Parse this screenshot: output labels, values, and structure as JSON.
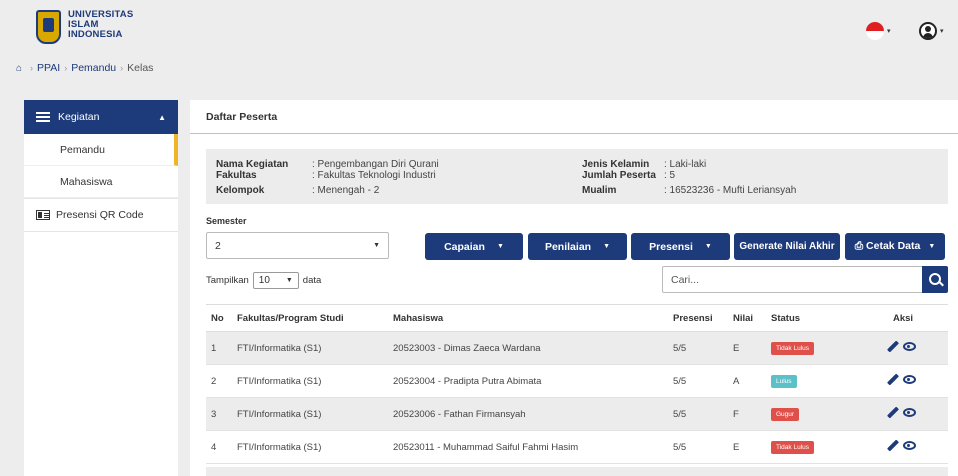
{
  "brand": {
    "line1": "UNIVERSITAS",
    "line2": "ISLAM",
    "line3": "INDONESIA",
    "colors": {
      "primary": "#1d3a7a",
      "accent": "#f0b429"
    }
  },
  "header": {
    "language_icon": "indonesia-flag-icon",
    "user_icon": "user-circle-icon"
  },
  "breadcrumb": {
    "items": [
      "PPAI",
      "Pemandu",
      "Kelas"
    ]
  },
  "sidebar": {
    "kegiatan": "Kegiatan",
    "sub_items": [
      "Pemandu",
      "Mahasiswa"
    ],
    "presensi_qr": "Presensi QR Code"
  },
  "panel": {
    "title": "Daftar Peserta",
    "info": {
      "nama_kegiatan_label": "Nama Kegiatan",
      "nama_kegiatan_value": ": Pengembangan Diri Qurani",
      "fakultas_label": "Fakultas",
      "fakultas_value": ": Fakultas Teknologi Industri",
      "kelompok_label": "Kelompok",
      "kelompok_value": ": Menengah - 2",
      "jenis_kelamin_label": "Jenis Kelamin",
      "jenis_kelamin_value": ": Laki-laki",
      "jumlah_peserta_label": "Jumlah Peserta",
      "jumlah_peserta_value": ": 5",
      "mualim_label": "Mualim",
      "mualim_value": ": 16523236 - Mufti Leriansyah"
    },
    "semester_label": "Semester",
    "semester_value": "2",
    "buttons": {
      "capaian": "Capaian",
      "penilaian": "Penilaian",
      "presensi": "Presensi",
      "generate": "Generate Nilai Akhir",
      "cetak": "⎙ Cetak Data"
    },
    "show_prefix": "Tampilkan",
    "show_value": "10",
    "show_suffix": "data",
    "search_placeholder": "Cari..."
  },
  "table": {
    "headers": {
      "no": "No",
      "fakultas": "Fakultas/Program Studi",
      "mahasiswa": "Mahasiswa",
      "presensi": "Presensi",
      "nilai": "Nilai",
      "status": "Status",
      "aksi": "Aksi"
    },
    "rows": [
      {
        "no": "1",
        "fakultas": "FTI/Informatika (S1)",
        "mahasiswa": "20523003 - Dimas Zaeca Wardana",
        "presensi": "5/5",
        "nilai": "E",
        "status": "Tidak Lulus",
        "status_color": "#e0504a"
      },
      {
        "no": "2",
        "fakultas": "FTI/Informatika (S1)",
        "mahasiswa": "20523004 - Pradipta Putra Abimata",
        "presensi": "5/5",
        "nilai": "A",
        "status": "Lulus",
        "status_color": "#5bc0c8"
      },
      {
        "no": "3",
        "fakultas": "FTI/Informatika (S1)",
        "mahasiswa": "20523006 - Fathan Firmansyah",
        "presensi": "5/5",
        "nilai": "F",
        "status": "Gugur",
        "status_color": "#e0504a"
      },
      {
        "no": "4",
        "fakultas": "FTI/Informatika (S1)",
        "mahasiswa": "20523011 - Muhammad Saiful Fahmi Hasim",
        "presensi": "5/5",
        "nilai": "E",
        "status": "Tidak Lulus",
        "status_color": "#e0504a"
      }
    ]
  }
}
